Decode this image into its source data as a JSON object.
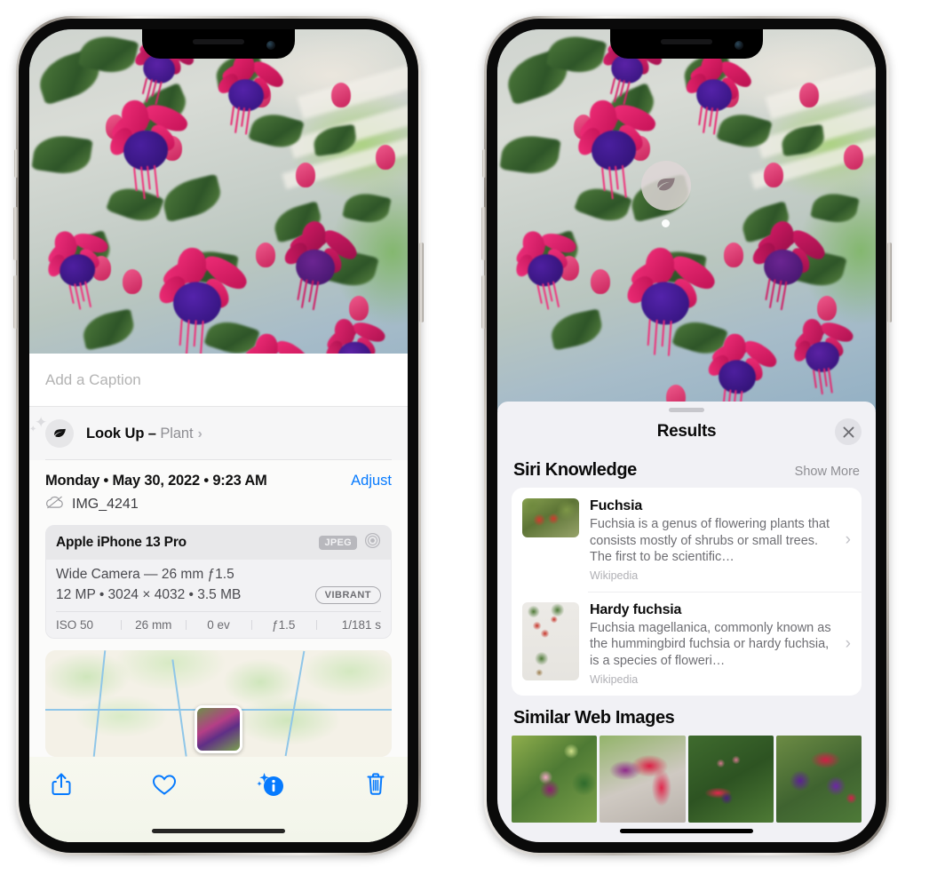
{
  "left_phone": {
    "caption_placeholder": "Add a Caption",
    "lookup": {
      "label": "Look Up –",
      "subject": "Plant",
      "chevron": "›",
      "icon": "leaf-icon"
    },
    "metadata": {
      "date_line": "Monday • May 30, 2022 • 9:23 AM",
      "adjust_label": "Adjust",
      "filename": "IMG_4241",
      "cloud_icon": "cloud-slash-icon"
    },
    "camera_card": {
      "device": "Apple iPhone 13 Pro",
      "format_badge": "JPEG",
      "hdr_icon": "aperture-icon",
      "lens_line": "Wide Camera — 26 mm ƒ1.5",
      "size_line": "12 MP • 3024 × 4032 • 3.5 MB",
      "style_badge": "VIBRANT",
      "exif": [
        "ISO 50",
        "26 mm",
        "0 ev",
        "ƒ1.5",
        "1/181 s"
      ]
    },
    "toolbar": [
      {
        "name": "share-button",
        "icon": "share-icon"
      },
      {
        "name": "favorite-button",
        "icon": "heart-icon"
      },
      {
        "name": "info-button",
        "icon": "info-sparkle-icon"
      },
      {
        "name": "delete-button",
        "icon": "trash-icon"
      }
    ]
  },
  "right_phone": {
    "callout_icon": "leaf-icon",
    "sheet": {
      "title": "Results",
      "close_icon": "close-icon",
      "siri_section": {
        "title": "Siri Knowledge",
        "show_more": "Show More",
        "items": [
          {
            "name": "Fuchsia",
            "description": "Fuchsia is a genus of flowering plants that consists mostly of shrubs or small trees. The first to be scientific…",
            "source": "Wikipedia",
            "chevron": "›"
          },
          {
            "name": "Hardy fuchsia",
            "description": "Fuchsia magellanica, commonly known as the hummingbird fuchsia or hardy fuchsia, is a species of floweri…",
            "source": "Wikipedia",
            "chevron": "›"
          }
        ]
      },
      "similar_section": {
        "title": "Similar Web Images",
        "images": [
          "fuchsia-web-image-1",
          "fuchsia-web-image-2",
          "fuchsia-web-image-3",
          "fuchsia-web-image-4"
        ]
      }
    }
  },
  "colors": {
    "accent_blue": "#067afe",
    "sheet_bg": "#f1f1f5",
    "card_bg": "#ffffff",
    "secondary_text": "#8e8e93"
  }
}
